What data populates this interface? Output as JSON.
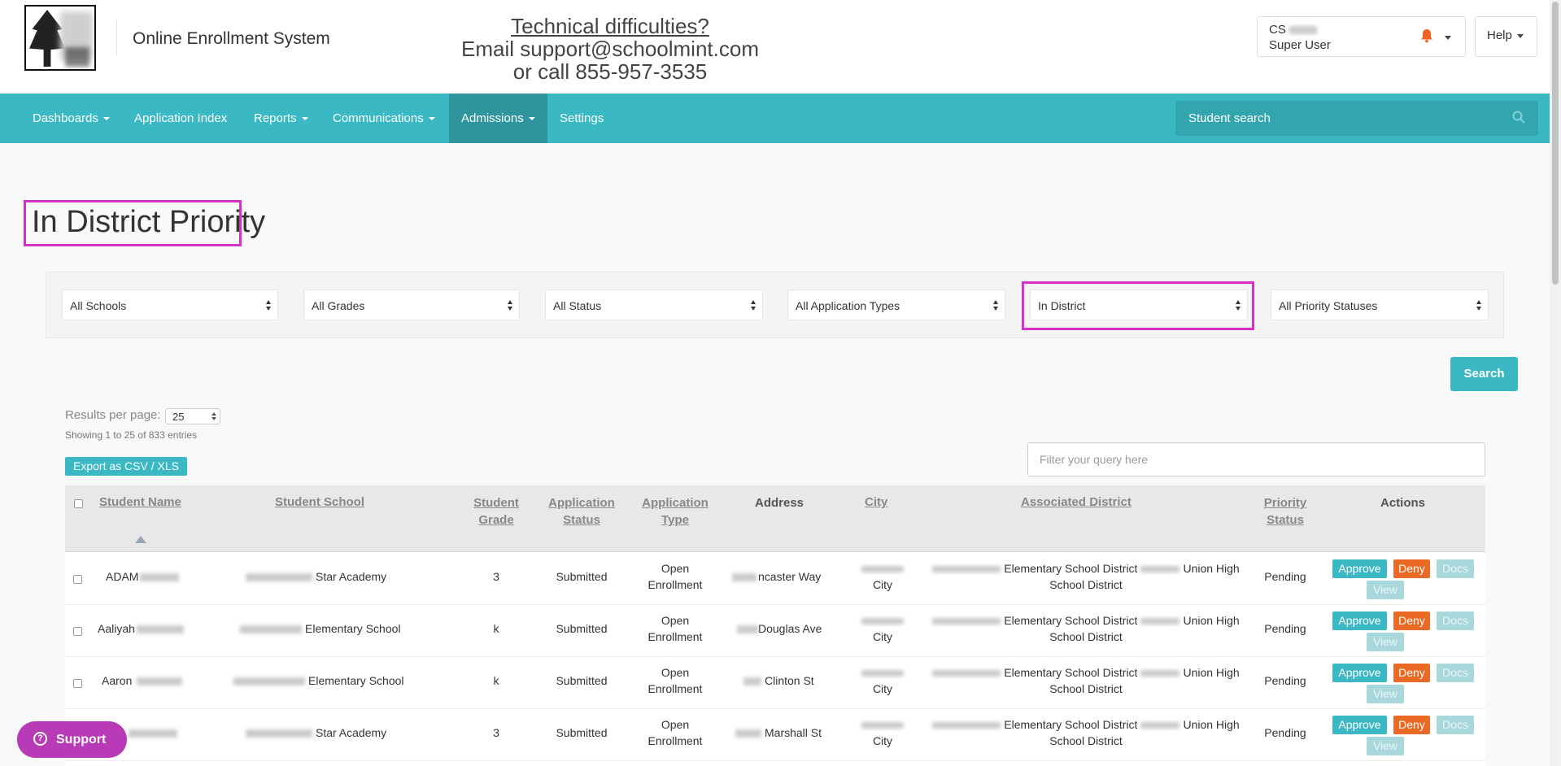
{
  "header": {
    "app_name": "Online Enrollment System",
    "contact": {
      "line1": "Technical difficulties?",
      "line2": "Email support@schoolmint.com",
      "line3": "or call 855-957-3535"
    },
    "user": {
      "name": "CS",
      "role": "Super User"
    },
    "help_label": "Help"
  },
  "nav": {
    "items": [
      {
        "label": "Dashboards",
        "dropdown": true
      },
      {
        "label": "Application Index",
        "dropdown": false
      },
      {
        "label": "Reports",
        "dropdown": true
      },
      {
        "label": "Communications",
        "dropdown": true
      },
      {
        "label": "Admissions",
        "dropdown": true,
        "active": true
      },
      {
        "label": "Settings",
        "dropdown": false
      }
    ],
    "search_placeholder": "Student search"
  },
  "page": {
    "title": "In District Priority"
  },
  "filters": {
    "schools": "All Schools",
    "grades": "All Grades",
    "status": "All Status",
    "application_types": "All Application Types",
    "district": "In District",
    "priority_statuses": "All Priority Statuses"
  },
  "search_label": "Search",
  "results": {
    "per_page_label": "Results per page:",
    "per_page_value": "25",
    "showing": "Showing 1 to 25 of 833 entries",
    "export_label": "Export as CSV / XLS",
    "filter_placeholder": "Filter your query here"
  },
  "table": {
    "headers": {
      "student_name": "Student Name",
      "student_school": "Student School",
      "student_grade_1": "Student",
      "student_grade_2": "Grade",
      "application_status_1": "Application",
      "application_status_2": "Status",
      "application_type_1": "Application",
      "application_type_2": "Type",
      "address": "Address",
      "city": "City",
      "associated_district": "Associated District",
      "priority_status_1": "Priority",
      "priority_status_2": "Status",
      "actions": "Actions"
    },
    "rows": [
      {
        "name": "ADAM",
        "school": "Star Academy",
        "grade": "3",
        "status": "Submitted",
        "type_1": "Open",
        "type_2": "Enrollment",
        "address": "ncaster Way",
        "city": "City",
        "district_1": "Elementary School District",
        "district_2": "Union High",
        "district_3": "School District",
        "priority": "Pending"
      },
      {
        "name": "Aaliyah",
        "school": "Elementary School",
        "grade": "k",
        "status": "Submitted",
        "type_1": "Open",
        "type_2": "Enrollment",
        "address": "Douglas Ave",
        "city": "City",
        "district_1": "Elementary School District",
        "district_2": "Union High",
        "district_3": "School District",
        "priority": "Pending"
      },
      {
        "name": "Aaron",
        "school": "Elementary School",
        "grade": "k",
        "status": "Submitted",
        "type_1": "Open",
        "type_2": "Enrollment",
        "address": "Clinton St",
        "city": "City",
        "district_1": "Elementary School District",
        "district_2": "Union High",
        "district_3": "School District",
        "priority": "Pending"
      },
      {
        "name": "",
        "school": "Star Academy",
        "grade": "3",
        "status": "Submitted",
        "type_1": "Open",
        "type_2": "Enrollment",
        "address": "Marshall St",
        "city": "City",
        "district_1": "Elementary School District",
        "district_2": "Union High",
        "district_3": "School District",
        "priority": "Pending"
      }
    ],
    "action_labels": {
      "approve": "Approve",
      "deny": "Deny",
      "docs": "Docs",
      "view": "View"
    }
  },
  "support_label": "Support",
  "colors": {
    "nav": "#3ab9c4",
    "nav_active": "#2e959e",
    "approve": "#3ab9c4",
    "deny": "#ea6a25",
    "highlight": "#d630c9",
    "support": "#b93ab6"
  },
  "icons": [
    "tree-logo",
    "bell-icon",
    "search-icon",
    "sort-asc-icon",
    "help-circle-icon"
  ]
}
